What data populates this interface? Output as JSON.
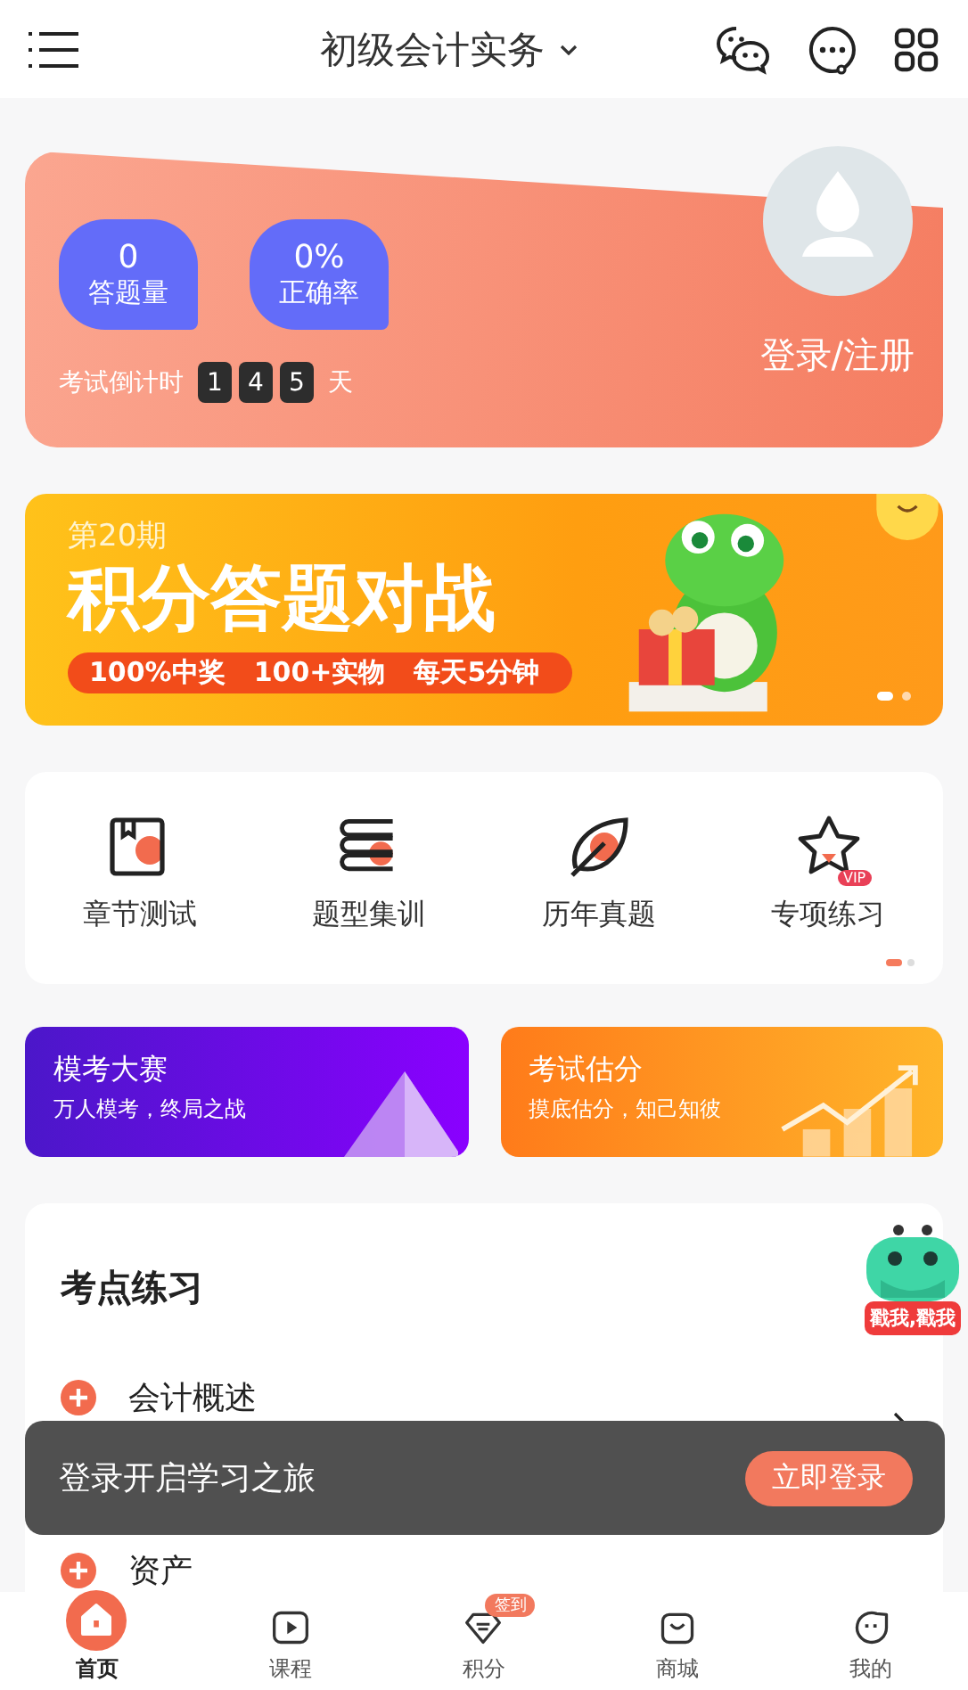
{
  "header": {
    "title": "初级会计实务"
  },
  "profile": {
    "stats": [
      {
        "value": "0",
        "label": "答题量"
      },
      {
        "value": "0%",
        "label": "正确率"
      }
    ],
    "countdown_label": "考试倒计时",
    "countdown_digits": [
      "1",
      "4",
      "5"
    ],
    "countdown_unit": "天",
    "login": "登录/注册"
  },
  "banner": {
    "issue": "第20期",
    "title": "积分答题对战",
    "tagline": [
      "100%中奖",
      "100+实物",
      "每天5分钟"
    ],
    "dots": [
      {
        "selected": true
      },
      {
        "selected": false
      }
    ]
  },
  "shortcuts": [
    {
      "kind": "book",
      "label": "章节测试"
    },
    {
      "kind": "stack",
      "label": "题型集训"
    },
    {
      "kind": "leaf",
      "label": "历年真题"
    },
    {
      "kind": "star",
      "label": "专项练习",
      "badge": "VIP"
    }
  ],
  "shortcut_pages": [
    {
      "selected": true
    },
    {
      "selected": false
    }
  ],
  "promos": [
    {
      "kind": "pyramid",
      "title": "模考大赛",
      "subtitle": "万人模考，终局之战"
    },
    {
      "kind": "growth",
      "title": "考试估分",
      "subtitle": "摸底估分，知己知彼"
    }
  ],
  "practice": {
    "title": "考点练习",
    "topics": [
      {
        "name": "会计概述"
      },
      {
        "name": "资产"
      }
    ]
  },
  "mascot": {
    "label": "戳我,戳我"
  },
  "toast": {
    "message": "登录开启学习之旅",
    "action": "立即登录"
  },
  "tabs": [
    {
      "kind": "home",
      "label": "首页",
      "selected": true
    },
    {
      "kind": "play",
      "label": "课程",
      "selected": false
    },
    {
      "kind": "points",
      "label": "积分",
      "selected": false,
      "badge": "签到"
    },
    {
      "kind": "bag",
      "label": "商城",
      "selected": false
    },
    {
      "kind": "face",
      "label": "我的",
      "selected": false
    }
  ]
}
